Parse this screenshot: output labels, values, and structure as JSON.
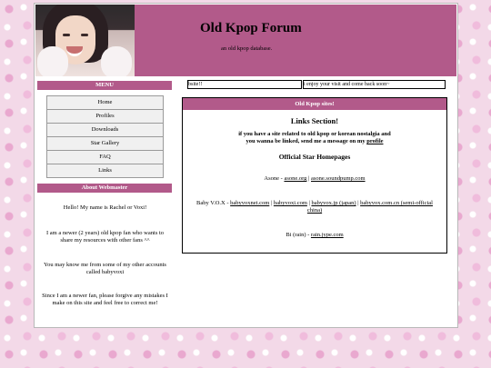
{
  "header": {
    "title": "Old Kpop Forum",
    "subtitle": "an old kpop database."
  },
  "menu": {
    "title": "MENU",
    "items": [
      "Home",
      "Profiles",
      "Downloads",
      "Star Gallery",
      "FAQ",
      "Links"
    ]
  },
  "about": {
    "title": "About Webmaster",
    "paragraphs": [
      "Hello! My name is Rachel or Voxi!",
      "I am a newer (2 years) old kpop fan who wants to share my resources with other fans ^^",
      "You may know me from some of my other accounts called babyvoxi",
      "Since I am a newer fan, please forgive any mistakes I make on this site and feel free to correct me!"
    ]
  },
  "tickers": {
    "left": "bsite!!",
    "right": "i enjoy your visit and come back soon~"
  },
  "main": {
    "panel_title": "Old Kpop sites!",
    "links_heading": "Links Section!",
    "intro_line1": "if you have a site related to old kpop or korean nostalgia and",
    "intro_line2": "you wanna be linked, send me a message on my",
    "intro_link": "profile",
    "star_heading": "Official Star Homepages",
    "asone": {
      "label": "Asone - ",
      "link1": "asone.org",
      "sep": " | ",
      "link2": "asone.soundpump.com"
    },
    "babyvox": {
      "label": "Baby V.O.X - ",
      "link1": "babyvoxnet.com",
      "link2": "babyvoxi.com",
      "link3": "babyvox.jp (japan)",
      "link4": "babyvox.com.cn (semi-official china)",
      "sep": " | "
    },
    "bi": {
      "label": "Bi (rain) - ",
      "link1": "rain.jype.com"
    }
  }
}
